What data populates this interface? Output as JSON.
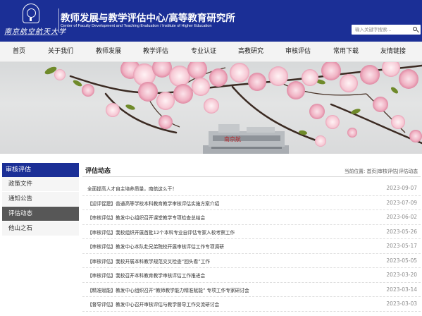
{
  "header": {
    "logo_text": "南京航空航天大学",
    "title": "教师发展与教学评估中心/高等教育研究所",
    "subtitle": "Center of Faculty Development and Teaching Evaluation / Institute of Higher Education",
    "search_placeholder": "输入关键字搜索...",
    "colors": {
      "brand": "#1b2f96"
    }
  },
  "nav": {
    "items": [
      "首页",
      "关于我们",
      "教师发展",
      "教学评估",
      "专业认证",
      "高教研究",
      "审核评估",
      "常用下载",
      "友情链接"
    ]
  },
  "banner": {
    "sign_text": "南京航"
  },
  "sidebar": {
    "heading": "审核评估",
    "items": [
      "政策文件",
      "通知公告",
      "评估动态",
      "他山之石"
    ],
    "active_index": 2
  },
  "main": {
    "title": "评估动态",
    "breadcrumb": {
      "prefix": "当前位置:",
      "items": [
        "首页",
        "审核评估",
        "评估动态"
      ],
      "separator": "|"
    },
    "news": [
      {
        "title": "全面提高人才自主培养质量，南航这么干！",
        "date": "2023-09-07"
      },
      {
        "title": "【迎评促建】普通高等学校本科教育教学审核评估实施方案介绍",
        "date": "2023-07-09"
      },
      {
        "title": "【审核评估】教发中心组织召开课堂教学专项检查总结会",
        "date": "2023-06-02"
      },
      {
        "title": "【审核评估】我校组织开展首批12个本科专业自评估专家入校考察工作",
        "date": "2023-05-26"
      },
      {
        "title": "【审核评估】教发中心本队赴兄弟院校开展审核评估工作专项调研",
        "date": "2023-05-17"
      },
      {
        "title": "【审核评估】我校开展本科教学规范交叉检查“回头看”工作",
        "date": "2023-05-05"
      },
      {
        "title": "【审核评估】我校召开本科教育教学审核评估工作推进会",
        "date": "2023-03-20"
      },
      {
        "title": "【精准赋能】教发中心组织召开“教师教学能力精准赋能” 专项工作专家研讨会",
        "date": "2023-03-14"
      },
      {
        "title": "【督导评估】教发中心召开审核评估与教学督导工作交流研讨会",
        "date": "2023-03-03"
      }
    ]
  }
}
